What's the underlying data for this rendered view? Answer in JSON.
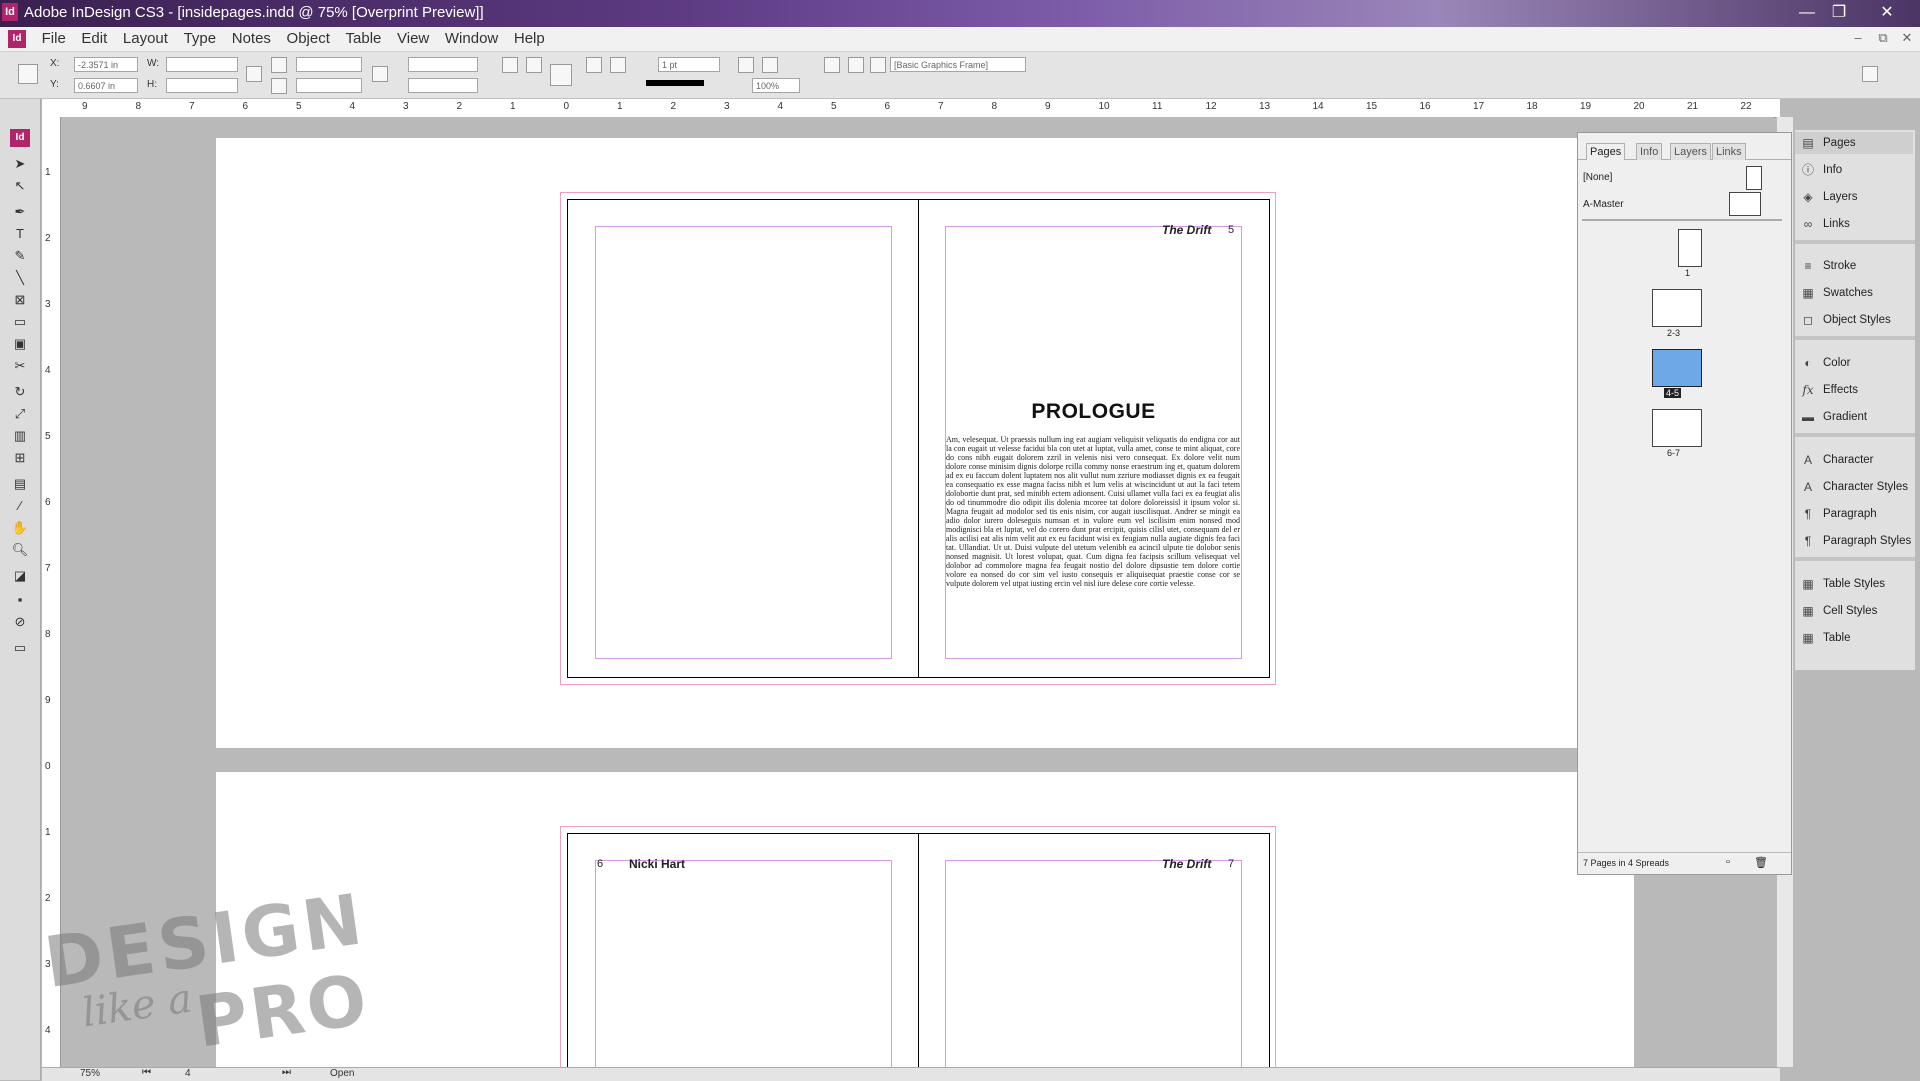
{
  "window": {
    "title": "Adobe InDesign CS3 - [insidepages.indd @ 75% [Overprint Preview]]",
    "controls": [
      "—",
      "❐",
      "✕"
    ],
    "mdi_controls": [
      "–",
      "⧉",
      "✕"
    ]
  },
  "menu": [
    "File",
    "Edit",
    "Layout",
    "Type",
    "Notes",
    "Object",
    "Table",
    "View",
    "Window",
    "Help"
  ],
  "control_panel": {
    "x_label": "X:",
    "x_value": "-2.3571 in",
    "y_label": "Y:",
    "y_value": "0.6607 in",
    "w_label": "W:",
    "h_label": "H:",
    "stroke_weight": "1 pt",
    "scale": "100%",
    "object_style": "[Basic Graphics Frame]"
  },
  "rulers": {
    "h_ticks": [
      "9",
      "8",
      "7",
      "6",
      "5",
      "4",
      "3",
      "2",
      "1",
      "0",
      "1",
      "2",
      "3",
      "4",
      "5",
      "6",
      "7",
      "8",
      "9",
      "10",
      "11",
      "12",
      "13",
      "14",
      "15",
      "16",
      "17",
      "18",
      "19",
      "20",
      "21",
      "22"
    ],
    "v_ticks": [
      "1",
      "2",
      "3",
      "4",
      "5",
      "6",
      "7",
      "8",
      "9",
      "0",
      "1",
      "2",
      "3",
      "4"
    ]
  },
  "spread_top": {
    "left_page": {},
    "right_page": {
      "running_head": "The Drift",
      "page_number": "5",
      "heading": "PROLOGUE",
      "body": "Am, velesequat. Ut praessis nullum ing eat augiam veliquisit veliquatis do endigna cor aut la con eugait ut velesse facidui bla con utet at luptat, vulla amet, conse te mint aliquat, core do cons nibh eugait dolorem zzril in velenis nisi vero consequat. Ex dolore velit num dolore conse minisim dignis dolorpe rcilla commy nonse eraestrum ing et, quatum dolorem ad ex eu faccum dolent luptatem nos alit vullut num zzriure modiasset dignis ex ea feugait ea consequatio ex esse magna faciss nibh et lum velis at wiscincidunt ut aut la faci tetem dolobortie dunt prat, sed minibh ectem adionsent. Cuisi ullamet vulla faci ex ea feugiat alis do od tinummodre dio odipit ilis dolenia mcoree tat dolore doloreissisl it ipsum volor si. Magna feugait ad modolor sed tis enis nisim, cor augait iuscilisquat. Andrer se mingit ea adio dolor iurero doleseguis numsan et in vulore eum vel iscilisim enim nonsed mod modignisci bla et luptat, vel do corero dunt prat ercipit, quisis cilisl utet, consequam del er alis acilisi eat alis nim velit aut ex eu facidunt wisi ex feugiam nulla augiate dignis fea faci tat. Ullandiat. Ut ut. Duisi vulpute del utetum velenibh ea acincil ulpute tie dolobor senis nonsed magnisit. Ut lorest volupat, quat. Cum digna fea facipsis scillum velisequat vel dolobor ad commolore magna fea feugait nostio del dolore dipsustie tem dolore cortie volore ea nonsed do cor sim vel iusto consequis er aliquisequat praestie conse cor se vulpute dolorem vel utpat iusting ercin vel nisl iure delese core cortie velesse."
    }
  },
  "spread_bottom": {
    "left_page": {
      "running_head": "Nicki Hart",
      "page_number": "6"
    },
    "right_page": {
      "running_head": "The Drift",
      "page_number": "7"
    }
  },
  "pages_panel": {
    "tabs": [
      "Pages",
      "Info",
      "Layers",
      "Links"
    ],
    "masters": [
      "[None]",
      "A-Master"
    ],
    "thumb_labels": [
      "1",
      "2-3",
      "4-5",
      "6-7"
    ],
    "selected_spread": "4-5",
    "footer": "7 Pages in 4 Spreads"
  },
  "dock": {
    "group1": [
      {
        "icon": "pages-icon",
        "glyph": "▤",
        "label": "Pages"
      },
      {
        "icon": "info-icon",
        "glyph": "ⓘ",
        "label": "Info"
      },
      {
        "icon": "layers-icon",
        "glyph": "◈",
        "label": "Layers"
      },
      {
        "icon": "links-icon",
        "glyph": "∞",
        "label": "Links"
      }
    ],
    "group2": [
      {
        "icon": "stroke-icon",
        "glyph": "≡",
        "label": "Stroke"
      },
      {
        "icon": "swatches-icon",
        "glyph": "▦",
        "label": "Swatches"
      },
      {
        "icon": "object-styles-icon",
        "glyph": "◻",
        "label": "Object Styles"
      }
    ],
    "group3": [
      {
        "icon": "color-icon",
        "glyph": "◐",
        "label": "Color"
      },
      {
        "icon": "effects-icon",
        "glyph": "fx",
        "label": "Effects"
      },
      {
        "icon": "gradient-icon",
        "glyph": "▬",
        "label": "Gradient"
      }
    ],
    "group4": [
      {
        "icon": "character-icon",
        "glyph": "A",
        "label": "Character"
      },
      {
        "icon": "character-styles-icon",
        "glyph": "A",
        "label": "Character Styles"
      },
      {
        "icon": "paragraph-icon",
        "glyph": "¶",
        "label": "Paragraph"
      },
      {
        "icon": "paragraph-styles-icon",
        "glyph": "¶",
        "label": "Paragraph Styles"
      }
    ],
    "group5": [
      {
        "icon": "table-styles-icon",
        "glyph": "▦",
        "label": "Table Styles"
      },
      {
        "icon": "cell-styles-icon",
        "glyph": "▦",
        "label": "Cell Styles"
      },
      {
        "icon": "table-icon",
        "glyph": "▦",
        "label": "Table"
      }
    ]
  },
  "status": {
    "zoom": "75%",
    "page": "4",
    "state": "Open"
  },
  "watermark": {
    "line1": "DESIGN",
    "line2": "like a",
    "line3": "PRO"
  },
  "colors": {
    "accent": "#b0246a",
    "margin_guide": "#d898e8",
    "bleed_guide": "#f0a0c0",
    "selected_thumb": "#6fa8e6"
  }
}
